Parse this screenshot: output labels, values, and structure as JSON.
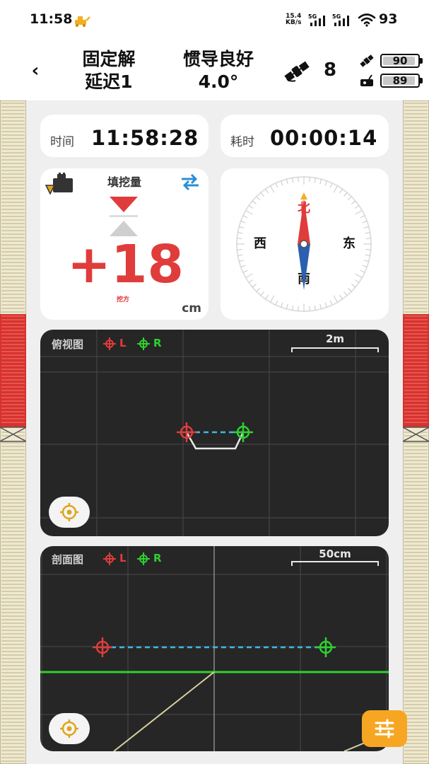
{
  "status_bar": {
    "time": "11:58",
    "net_speed_value": "15.4",
    "net_speed_unit": "KB/s",
    "sim1": "5G",
    "sim2": "5G",
    "battery": "93"
  },
  "header": {
    "solution_status": "固定解",
    "delay": "延迟1",
    "ins_status": "惯导良好",
    "ins_angle": "4.0°",
    "satellite_count": "8",
    "rover_battery": 90,
    "base_battery": 89
  },
  "time_card": {
    "label": "时间",
    "value": "11:58:28"
  },
  "elapsed_card": {
    "label": "耗时",
    "value": "00:00:14"
  },
  "fill_card": {
    "title": "填挖量",
    "value": "+18",
    "sub_label": "挖方",
    "unit": "cm"
  },
  "compass": {
    "north": "北",
    "south": "南",
    "east": "东",
    "west": "西",
    "heading_deg": 0
  },
  "top_view": {
    "title": "俯视图",
    "legend_left": "L",
    "legend_right": "R",
    "scale": "2m"
  },
  "section_view": {
    "title": "剖面图",
    "legend_left": "L",
    "legend_right": "R",
    "scale": "50cm"
  },
  "colors": {
    "accent_red": "#e03c3c",
    "accent_green": "#2fd12f",
    "guide_blue": "#3fb8e8",
    "fab_orange": "#f6a623",
    "swap_blue": "#2a8fd6"
  },
  "icons": {
    "back": "‹",
    "settings": "sliders-icon",
    "locate": "crosshair-icon",
    "swap": "swap-arrows-icon",
    "satellite": "satellite-icon"
  }
}
